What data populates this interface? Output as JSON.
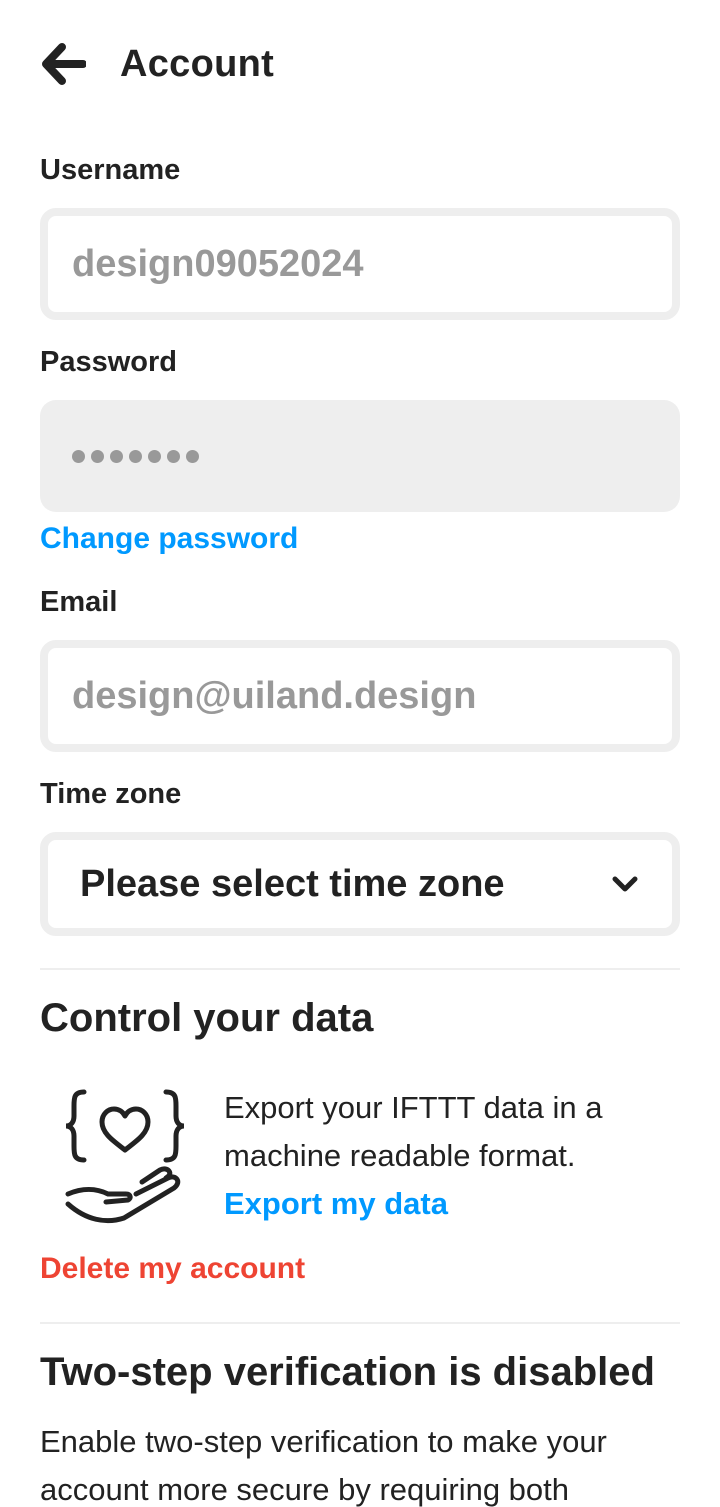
{
  "header": {
    "title": "Account",
    "back_icon": "arrow-left-icon"
  },
  "username": {
    "label": "Username",
    "value": "design09052024"
  },
  "password": {
    "label": "Password",
    "masked_length": 7,
    "change_link": "Change password"
  },
  "email": {
    "label": "Email",
    "value": "design@uiland.design"
  },
  "timezone": {
    "label": "Time zone",
    "selected": "Please select time zone",
    "icon": "chevron-down-icon"
  },
  "control_data": {
    "title": "Control your data",
    "icon": "data-heart-hand-icon",
    "description": "Export your IFTTT data in a machine readable format.",
    "export_link": "Export my data",
    "delete_link": "Delete my account"
  },
  "two_step": {
    "title": "Two-step verification is disabled",
    "description": "Enable two-step verification to make your account more secure by requiring both"
  },
  "colors": {
    "link": "#0099ff",
    "danger": "#ee4433",
    "text": "#222222",
    "muted": "#999999",
    "border": "#eeeeee"
  }
}
